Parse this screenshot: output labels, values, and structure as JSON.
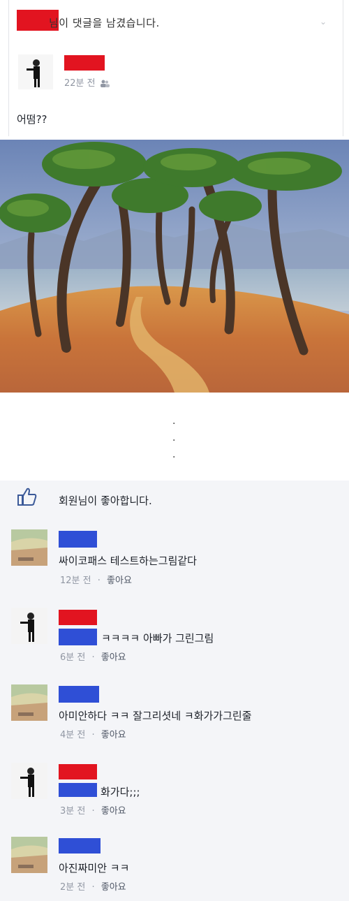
{
  "notification": {
    "text": "님이 댓글을 남겼습니다.",
    "chevron": "⌄"
  },
  "post": {
    "time": "22분 전",
    "privacy_icon": "friends-icon",
    "text": "어떰??",
    "image_icon": "pine-tree-painting"
  },
  "separator_dots": [
    ".",
    ".",
    "."
  ],
  "likes": {
    "icon": "thumbs-up-icon",
    "text": "회원님이 좋아합니다."
  },
  "comments": [
    {
      "avatar": "painting-avatar",
      "text": "싸이코패스 테스트하는그림같다",
      "time": "12분 전",
      "like_label": "좋아요"
    },
    {
      "avatar": "person-avatar",
      "text": "ㅋㅋㅋㅋ 아빠가 그린그림",
      "time": "6분 전",
      "like_label": "좋아요"
    },
    {
      "avatar": "painting-avatar",
      "text": "아미안하다 ㅋㅋ 잘그리셧네 ㅋ화가가그린줄",
      "time": "4분 전",
      "like_label": "좋아요"
    },
    {
      "avatar": "person-avatar",
      "text": "화가다;;;",
      "time": "3분 전",
      "like_label": "좋아요"
    },
    {
      "avatar": "painting-avatar",
      "text": "아진짜미안 ㅋㅋ",
      "time": "2분 전",
      "like_label": "좋아요"
    }
  ],
  "meta_separator": "·",
  "colors": {
    "redact_red": "#e21420",
    "redact_blue": "#2f4fd6",
    "like_blue": "#3b5998"
  }
}
